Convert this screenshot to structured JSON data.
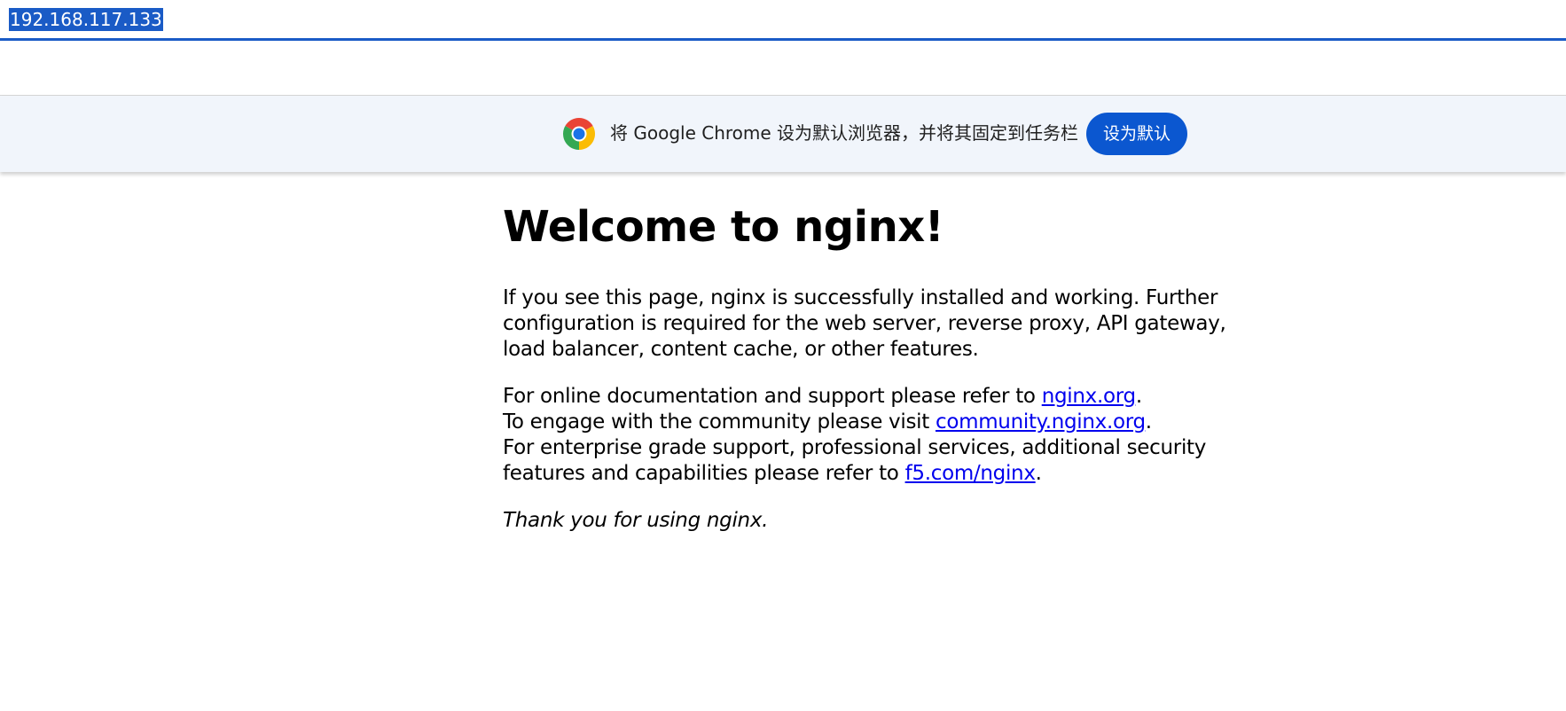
{
  "address_bar": {
    "url": "192.168.117.133"
  },
  "infobar": {
    "message": "将 Google Chrome 设为默认浏览器，并将其固定到任务栏",
    "button_label": "设为默认",
    "icon": "chrome-logo-icon",
    "colors": {
      "background": "#f1f5fb",
      "button": "#0b57d0"
    }
  },
  "page": {
    "title": "Welcome to nginx!",
    "intro": "If you see this page, nginx is successfully installed and working. Further configuration is required for the web server, reverse proxy, API gateway, load balancer, content cache, or other features.",
    "docs_prefix": "For online documentation and support please refer to ",
    "docs_link": "nginx.org",
    "docs_suffix": ".",
    "community_prefix": "To engage with the community please visit ",
    "community_link": "community.nginx.org",
    "community_suffix": ".",
    "enterprise_prefix": "For enterprise grade support, professional services, additional security features and capabilities please refer to ",
    "enterprise_link": "f5.com/nginx",
    "enterprise_suffix": ".",
    "thanks": "Thank you for using nginx.",
    "colors": {
      "link": "#0000ee",
      "selection": "#1a5bc6"
    }
  }
}
